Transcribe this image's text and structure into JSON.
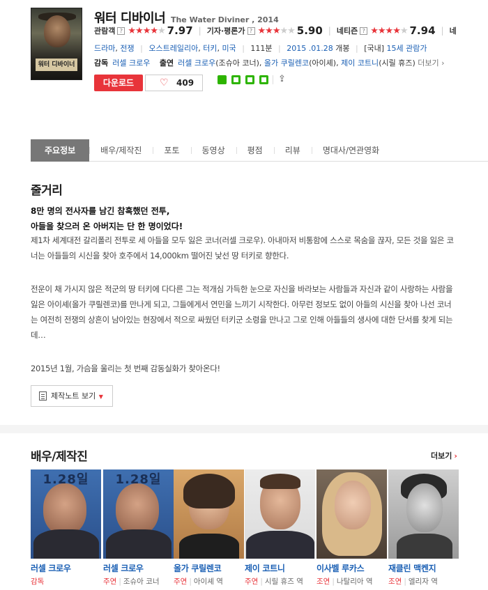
{
  "movie": {
    "title_ko": "워터 디바이너",
    "title_en": "The Water Diviner , 2014",
    "poster_text": "워터 디바이너"
  },
  "ratings": [
    {
      "label": "관람객",
      "score": "7.97",
      "stars": 4
    },
    {
      "label": "기자·평론가",
      "score": "5.90",
      "stars": 3
    },
    {
      "label": "네티즌",
      "score": "7.94",
      "stars": 4
    }
  ],
  "rating_help": "?",
  "ratings_overflow": "네",
  "meta": {
    "genres": [
      "드라마",
      "전쟁"
    ],
    "countries": [
      "오스트레일리아",
      "터키",
      "미국"
    ],
    "runtime": "111분",
    "release_date": "2015 .01.28",
    "release_suffix": "개봉",
    "rating_prefix": "[국내]",
    "rating": "15세 관람가"
  },
  "credits": {
    "director_label": "감독",
    "director": "러셀 크로우",
    "cast_label": "출연",
    "cast": [
      {
        "name": "러셀 크로우",
        "role": "(조슈아 코너)"
      },
      {
        "name": "올가 쿠릴렌코",
        "role": "(아이셰)"
      },
      {
        "name": "제이 코트니",
        "role": "(시릴 휴즈)"
      }
    ],
    "more": "더보기"
  },
  "actions": {
    "download": "다운로드",
    "likes": "409"
  },
  "share": [
    "blog",
    "cafe",
    "bookmark",
    "memo",
    "export"
  ],
  "tabs": [
    "주요정보",
    "배우/제작진",
    "포토",
    "동영상",
    "평점",
    "리뷰",
    "명대사/연관영화"
  ],
  "synopsis": {
    "title": "줄거리",
    "tagline1": "8만 명의 전사자를 남긴 참혹했던 전투,",
    "tagline2": "아들을 찾으러 온 아버지는 단 한 명이었다!",
    "p1": "제1차 세계대전 갈리폴리 전투로 세 아들을 모두 잃은 코너(러셀 크로우). 아내마저 비통함에 스스로 목숨을 끊자, 모든 것을 잃은 코너는 아들들의 시신을 찾아 호주에서 14,000km 떨어진 낯선 땅 터키로 향한다.",
    "p2": " 전운이 채 가시지 않은 적군의 땅 터키에 다다른 그는 적개심 가득한 눈으로 자신을 바라보는 사람들과 자신과 같이 사랑하는 사람을 잃은 아이셰(올가 쿠릴렌코)를 만나게 되고, 그들에게서 연민을 느끼기 시작한다. 아무런 정보도 없이 아들의 시신을 찾아 나선 코너는 여전히 전쟁의 상흔이 남아있는 현장에서 적으로 싸웠던 터키군 소령을 만나고 그로 인해 아들들의 생사에 대한 단서를 찾게 되는데…",
    "p3": " 2015년 1월, 가슴을 울리는 첫 번째 감동실화가 찾아온다!",
    "note_button": "제작노트 보기"
  },
  "cast_section": {
    "title": "배우/제작진",
    "more": "더보기",
    "people": [
      {
        "name": "러셀 크로우",
        "kind": "감독",
        "role": ""
      },
      {
        "name": "러셀 크로우",
        "kind": "주연",
        "role": "조슈아 코너"
      },
      {
        "name": "올가 쿠릴렌코",
        "kind": "주연",
        "role": "아이셰 역"
      },
      {
        "name": "제이 코트니",
        "kind": "주연",
        "role": "시릴 휴즈 역"
      },
      {
        "name": "이사벨 루카스",
        "kind": "조연",
        "role": "나탈리아 역"
      },
      {
        "name": "재클린 맥켄지",
        "kind": "조연",
        "role": "엘리자 역"
      }
    ],
    "photo_banner": "1.28일"
  },
  "colors": {
    "accent": "#e8343a",
    "link": "#1a5fb4",
    "tab_active": "#777777"
  }
}
